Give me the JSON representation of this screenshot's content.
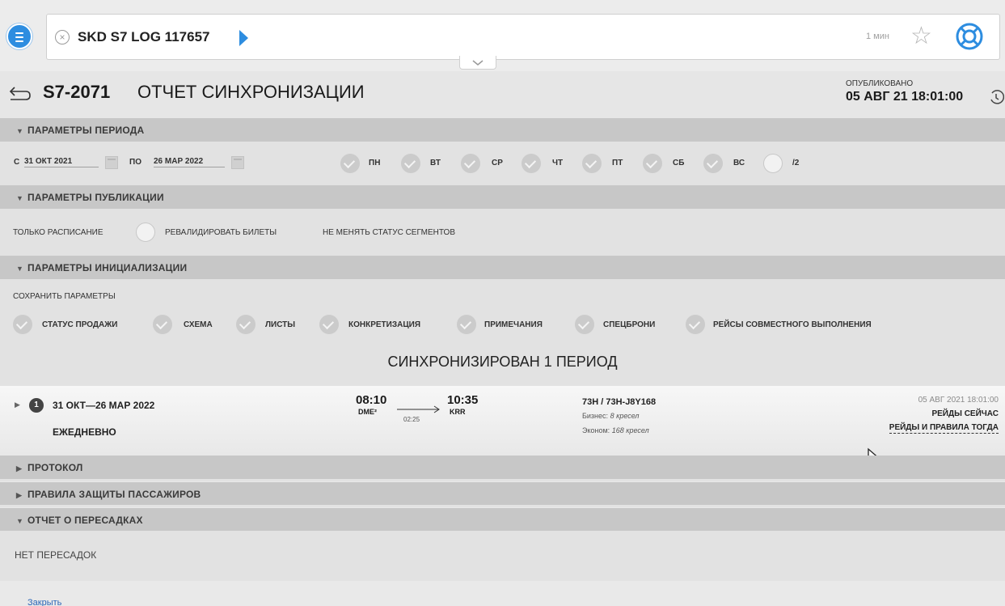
{
  "search": {
    "query": "SKD S7 LOG 117657",
    "age": "1 мин"
  },
  "header": {
    "flight": "S7-2071",
    "title": "ОТЧЕТ СИНХРОНИЗАЦИИ",
    "published_label": "ОПУБЛИКОВАНО",
    "published_date": "05 АВГ 21 18:01:00"
  },
  "sections": {
    "period": "ПАРАМЕТРЫ ПЕРИОДА",
    "publication": "ПАРАМЕТРЫ ПУБЛИКАЦИИ",
    "init": "ПАРАМЕТРЫ ИНИЦИАЛИЗАЦИИ",
    "protocol": "ПРОТОКОЛ",
    "protection": "ПРАВИЛА ЗАЩИТЫ ПАССАЖИРОВ",
    "transfers": "ОТЧЕТ О ПЕРЕСАДКАХ"
  },
  "period": {
    "from_label": "С",
    "from_date": "31 ОКТ 2021",
    "to_label": "ПО",
    "to_date": "26 МАР 2022",
    "days": [
      "ПН",
      "ВТ",
      "СР",
      "ЧТ",
      "ПТ",
      "СБ",
      "ВС",
      "/2"
    ],
    "days_checked": [
      true,
      true,
      true,
      true,
      true,
      true,
      true,
      false
    ]
  },
  "publication": {
    "schedule_only": "ТОЛЬКО РАСПИСАНИЕ",
    "revalidate": "РЕВАЛИДИРОВАТЬ БИЛЕТЫ",
    "keep_status": "НЕ МЕНЯТЬ СТАТУС СЕГМЕНТОВ"
  },
  "init": {
    "save_label": "СОХРАНИТЬ ПАРАМЕТРЫ",
    "items": [
      "СТАТУС ПРОДАЖИ",
      "СХЕМА",
      "ЛИСТЫ",
      "КОНКРЕТИЗАЦИЯ",
      "ПРИМЕЧАНИЯ",
      "СПЕЦБРОНИ",
      "РЕЙСЫ СОВМЕСТНОГО ВЫПОЛНЕНИЯ"
    ]
  },
  "result": {
    "heading": "СИНХРОНИЗИРОВАН 1 ПЕРИОД",
    "number": "1",
    "period": "31 ОКТ—26 МАР 2022",
    "frequency": "ЕЖЕДНЕВНО",
    "dep_time": "08:10",
    "dep_airport": "DME²",
    "duration": "02:25",
    "arr_time": "10:35",
    "arr_airport": "KRR",
    "aircraft": "73H / 73H-J8Y168",
    "business_label": "Бизнес:",
    "business_seats": "8 кресел",
    "economy_label": "Эконом:",
    "economy_seats": "168 кресел",
    "date": "05 АВГ 2021 18:01:00",
    "link_now": "РЕЙДЫ СЕЙЧАС",
    "link_then": "РЕЙДЫ И ПРАВИЛА ТОГДА"
  },
  "transfers": {
    "empty": "НЕТ ПЕРЕСАДОК"
  },
  "footer": {
    "close": "Закрыть"
  }
}
